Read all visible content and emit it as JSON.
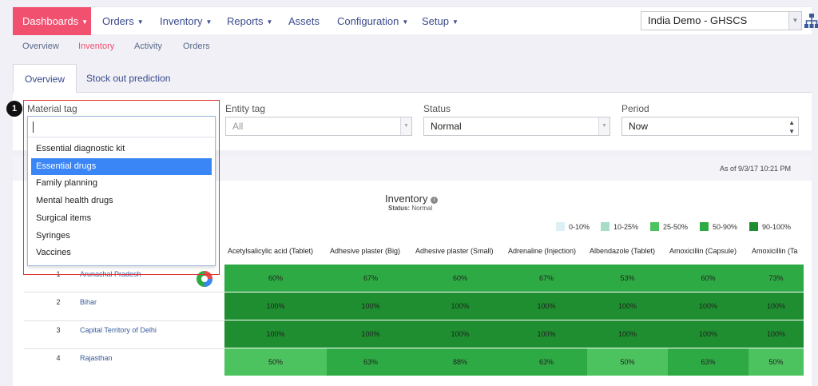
{
  "nav": {
    "items": [
      {
        "label": "Dashboards",
        "active": true,
        "left": 0
      },
      {
        "label": "Orders"
      },
      {
        "label": "Inventory"
      },
      {
        "label": "Reports"
      },
      {
        "label": "Assets"
      },
      {
        "label": "Configuration"
      },
      {
        "label": "Setup"
      }
    ],
    "domain": "India Demo - GHSCS",
    "tree_icon": "hierarchy-icon"
  },
  "subnav": {
    "items": [
      "Overview",
      "Inventory",
      "Activity",
      "Orders"
    ],
    "active": "Inventory"
  },
  "tabs": [
    "Overview",
    "Stock out prediction"
  ],
  "filters": {
    "material_tag": {
      "label": "Material tag",
      "value": ""
    },
    "entity_tag": {
      "label": "Entity tag",
      "value": "All"
    },
    "status": {
      "label": "Status",
      "value": "Normal"
    },
    "period": {
      "label": "Period",
      "value": "Now"
    }
  },
  "dropdown": {
    "options": [
      "Essential diagnostic kit",
      "Essential drugs",
      "Family planning",
      "Mental health drugs",
      "Surgical items",
      "Syringes",
      "Vaccines"
    ],
    "selected": "Essential drugs"
  },
  "callout": "1",
  "panel": {
    "as_of": "As of 9/3/17 10:21 PM",
    "title": "Inventory",
    "status_label": "Status:",
    "status_value": "Normal",
    "legend": [
      {
        "label": "0-10%",
        "color": "#ddf0f4"
      },
      {
        "label": "10-25%",
        "color": "#a8dcc4"
      },
      {
        "label": "25-50%",
        "color": "#4cc35e"
      },
      {
        "label": "50-90%",
        "color": "#2eaa44"
      },
      {
        "label": "90-100%",
        "color": "#1e8e30"
      }
    ],
    "columns": [
      "Acetylsalicylic acid (Tablet)",
      "Adhesive plaster (Big)",
      "Adhesive plaster (Small)",
      "Adrenaline (Injection)",
      "Albendazole (Tablet)",
      "Amoxicillin (Capsule)",
      "Amoxicillin (Ta"
    ],
    "rows": [
      {
        "num": "1",
        "name": "Arunachal Pradesh",
        "values": [
          "60%",
          "67%",
          "60%",
          "67%",
          "53%",
          "60%",
          "73%"
        ]
      },
      {
        "num": "2",
        "name": "Bihar",
        "values": [
          "100%",
          "100%",
          "100%",
          "100%",
          "100%",
          "100%",
          "100%"
        ]
      },
      {
        "num": "3",
        "name": "Capital Territory of Delhi",
        "values": [
          "100%",
          "100%",
          "100%",
          "100%",
          "100%",
          "100%",
          "100%"
        ]
      },
      {
        "num": "4",
        "name": "Rajasthan",
        "values": [
          "50%",
          "63%",
          "88%",
          "63%",
          "50%",
          "63%",
          "50%"
        ]
      }
    ]
  }
}
